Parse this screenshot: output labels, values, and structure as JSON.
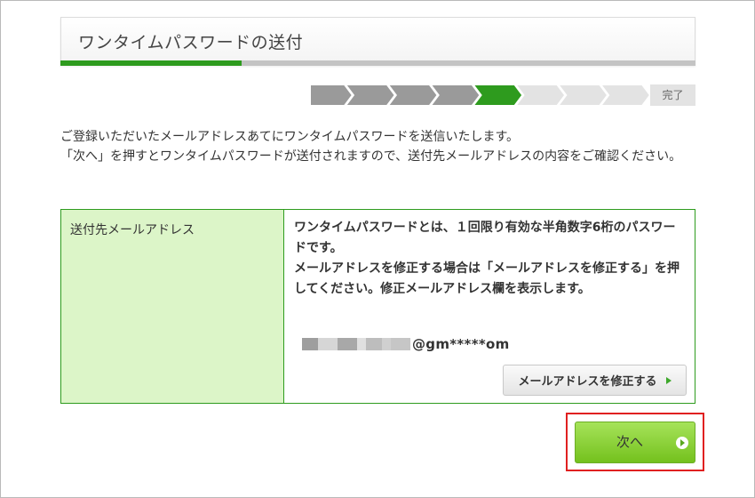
{
  "header": {
    "title": "ワンタイムパスワードの送付",
    "progress_fraction": 0.286
  },
  "stepper": {
    "total_steps": 8,
    "completed_steps": 4,
    "current_step": 5,
    "done_label": "完了",
    "colors": {
      "completed": "#9a9a9a",
      "current": "#2e9b1e",
      "pending": "#e3e3e3"
    }
  },
  "intro": {
    "line1": "ご登録いただいたメールアドレスあてにワンタイムパスワードを送信いたします。",
    "line2": "「次へ」を押すとワンタイムパスワードが送付されますので、送付先メールアドレスの内容をご確認ください。"
  },
  "table": {
    "label": "送付先メールアドレス",
    "note": "ワンタイムパスワードとは、１回限り有効な半角数字6桁のパスワードです。\nメールアドレスを修正する場合は「メールアドレスを修正する」を押してください。修正メールアドレス欄を表示します。",
    "email_masked_domain": "@gm*****om",
    "edit_button_label": "メールアドレスを修正する"
  },
  "actions": {
    "next_label": "次へ"
  },
  "colors": {
    "brand_green": "#2e9b1e",
    "label_cell_bg": "#dcf5c8",
    "highlight_border": "#e02020"
  }
}
